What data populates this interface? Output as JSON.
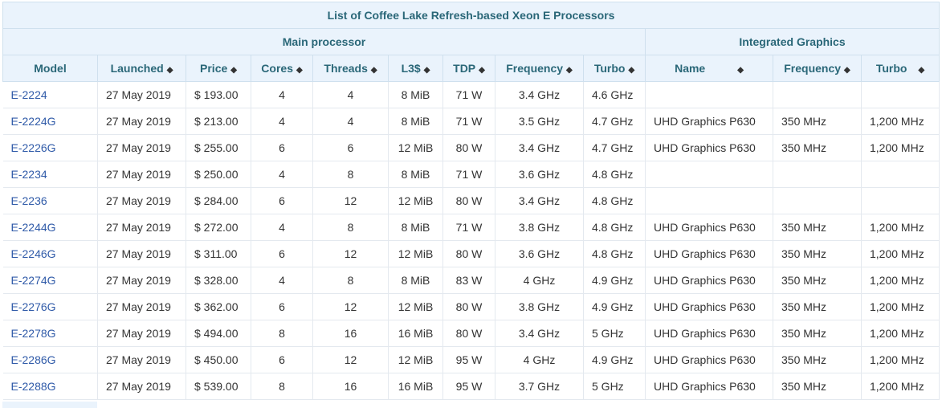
{
  "caption": "List of Coffee Lake Refresh-based Xeon E Processors",
  "groups": {
    "main": "Main processor",
    "graphics": "Integrated Graphics"
  },
  "columns": [
    "Model",
    "Launched",
    "Price",
    "Cores",
    "Threads",
    "L3$",
    "TDP",
    "Frequency",
    "Turbo",
    "Name",
    "Frequency",
    "Turbo"
  ],
  "sort_icon": "sort-updown-icon",
  "rows": [
    [
      "E-2224",
      "27 May 2019",
      "$ 193.00",
      "4",
      "4",
      "8 MiB",
      "71 W",
      "3.4 GHz",
      "4.6 GHz",
      "",
      "",
      ""
    ],
    [
      "E-2224G",
      "27 May 2019",
      "$ 213.00",
      "4",
      "4",
      "8 MiB",
      "71 W",
      "3.5 GHz",
      "4.7 GHz",
      "UHD Graphics P630",
      "350 MHz",
      "1,200 MHz"
    ],
    [
      "E-2226G",
      "27 May 2019",
      "$ 255.00",
      "6",
      "6",
      "12 MiB",
      "80 W",
      "3.4 GHz",
      "4.7 GHz",
      "UHD Graphics P630",
      "350 MHz",
      "1,200 MHz"
    ],
    [
      "E-2234",
      "27 May 2019",
      "$ 250.00",
      "4",
      "8",
      "8 MiB",
      "71 W",
      "3.6 GHz",
      "4.8 GHz",
      "",
      "",
      ""
    ],
    [
      "E-2236",
      "27 May 2019",
      "$ 284.00",
      "6",
      "12",
      "12 MiB",
      "80 W",
      "3.4 GHz",
      "4.8 GHz",
      "",
      "",
      ""
    ],
    [
      "E-2244G",
      "27 May 2019",
      "$ 272.00",
      "4",
      "8",
      "8 MiB",
      "71 W",
      "3.8 GHz",
      "4.8 GHz",
      "UHD Graphics P630",
      "350 MHz",
      "1,200 MHz"
    ],
    [
      "E-2246G",
      "27 May 2019",
      "$ 311.00",
      "6",
      "12",
      "12 MiB",
      "80 W",
      "3.6 GHz",
      "4.8 GHz",
      "UHD Graphics P630",
      "350 MHz",
      "1,200 MHz"
    ],
    [
      "E-2274G",
      "27 May 2019",
      "$ 328.00",
      "4",
      "8",
      "8 MiB",
      "83 W",
      "4 GHz",
      "4.9 GHz",
      "UHD Graphics P630",
      "350 MHz",
      "1,200 MHz"
    ],
    [
      "E-2276G",
      "27 May 2019",
      "$ 362.00",
      "6",
      "12",
      "12 MiB",
      "80 W",
      "3.8 GHz",
      "4.9 GHz",
      "UHD Graphics P630",
      "350 MHz",
      "1,200 MHz"
    ],
    [
      "E-2278G",
      "27 May 2019",
      "$ 494.00",
      "8",
      "16",
      "16 MiB",
      "80 W",
      "3.4 GHz",
      "5 GHz",
      "UHD Graphics P630",
      "350 MHz",
      "1,200 MHz"
    ],
    [
      "E-2286G",
      "27 May 2019",
      "$ 450.00",
      "6",
      "12",
      "12 MiB",
      "95 W",
      "4 GHz",
      "4.9 GHz",
      "UHD Graphics P630",
      "350 MHz",
      "1,200 MHz"
    ],
    [
      "E-2288G",
      "27 May 2019",
      "$ 539.00",
      "8",
      "16",
      "16 MiB",
      "95 W",
      "3.7 GHz",
      "5 GHz",
      "UHD Graphics P630",
      "350 MHz",
      "1,200 MHz"
    ]
  ]
}
